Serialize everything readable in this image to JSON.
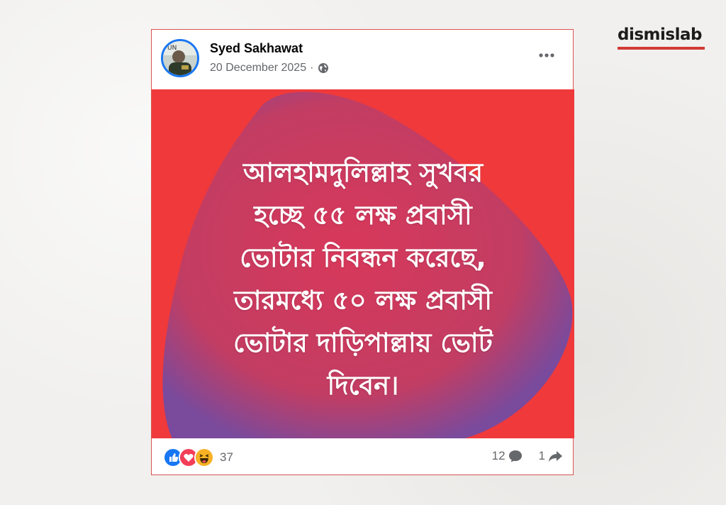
{
  "watermark": {
    "brand": "dismislab",
    "accent_color": "#d33a36"
  },
  "post": {
    "author": "Syed Sakhawat",
    "date": "20 December 2025",
    "separator": "·",
    "privacy_icon": "globe-icon",
    "menu_icon": "more-horizontal-icon",
    "text": "আলহামদুলিল্লাহ সুখবর\nহচ্ছে ৫৫ লক্ষ প্রবাসী\nভোটার নিবন্ধন করেছে,\nতারমধ্যে ৫০ লক্ষ প্রবাসী\nভোটার দাড়িপাল্লায় ভোট\nদিবেন।",
    "background_color": "#f0393b",
    "blob_color": "#7a4a9c"
  },
  "footer": {
    "reactions": [
      "like-icon",
      "love-icon",
      "haha-icon"
    ],
    "reaction_count": "37",
    "comment_count": "12",
    "share_count": "1"
  }
}
